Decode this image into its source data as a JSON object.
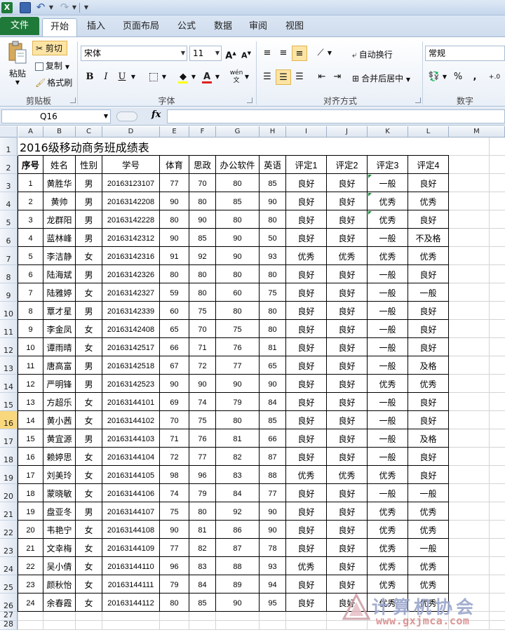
{
  "quick_access": {
    "app_icon": "X"
  },
  "tabs": [
    {
      "label": "文件",
      "icon": "excel-file-tab"
    },
    {
      "label": "开始"
    },
    {
      "label": "插入"
    },
    {
      "label": "页面布局"
    },
    {
      "label": "公式"
    },
    {
      "label": "数据"
    },
    {
      "label": "审阅"
    },
    {
      "label": "视图"
    }
  ],
  "ribbon": {
    "clipboard": {
      "paste": "粘贴",
      "cut": "剪切",
      "copy": "复制",
      "format_painter": "格式刷",
      "group": "剪贴板"
    },
    "font": {
      "name": "宋体",
      "size": "11",
      "bold": "B",
      "italic": "I",
      "underline": "U",
      "group": "字体",
      "grow": "A",
      "shrink": "A",
      "phonetic": "wén"
    },
    "alignment": {
      "wrap": "自动换行",
      "merge": "合并后居中",
      "group": "对齐方式"
    },
    "number": {
      "format": "常规",
      "percent": "%",
      "comma": ",",
      "group": "数字"
    }
  },
  "formula_bar": {
    "name_box": "Q16",
    "fx": "fx",
    "value": ""
  },
  "columns": [
    "A",
    "B",
    "C",
    "D",
    "E",
    "F",
    "G",
    "H",
    "I",
    "J",
    "K",
    "L",
    "M"
  ],
  "rows": [
    "1",
    "2",
    "3",
    "4",
    "5",
    "6",
    "7",
    "8",
    "9",
    "10",
    "11",
    "12",
    "13",
    "14",
    "15",
    "16",
    "17",
    "18",
    "19",
    "20",
    "21",
    "22",
    "23",
    "24",
    "25",
    "26",
    "27",
    "28"
  ],
  "selected_row": "16",
  "sheet": {
    "title": "2016级移动商务班成绩表",
    "headers": [
      "序号",
      "姓名",
      "性别",
      "学号",
      "体育",
      "思政",
      "办公软件",
      "英语",
      "评定1",
      "评定2",
      "评定3",
      "评定4"
    ],
    "records": [
      [
        "1",
        "黄胜华",
        "男",
        "20163123107",
        "77",
        "70",
        "80",
        "85",
        "良好",
        "良好",
        "一般",
        "良好"
      ],
      [
        "2",
        "黄帅",
        "男",
        "20163142208",
        "90",
        "80",
        "85",
        "90",
        "良好",
        "良好",
        "优秀",
        "优秀"
      ],
      [
        "3",
        "龙群阳",
        "男",
        "20163142228",
        "80",
        "90",
        "80",
        "80",
        "良好",
        "良好",
        "优秀",
        "良好"
      ],
      [
        "4",
        "蓝林峰",
        "男",
        "20163142312",
        "90",
        "85",
        "90",
        "50",
        "良好",
        "良好",
        "一般",
        "不及格"
      ],
      [
        "5",
        "李洁静",
        "女",
        "20163142316",
        "91",
        "92",
        "90",
        "93",
        "优秀",
        "优秀",
        "优秀",
        "优秀"
      ],
      [
        "6",
        "陆海斌",
        "男",
        "20163142326",
        "80",
        "80",
        "80",
        "80",
        "良好",
        "良好",
        "一般",
        "良好"
      ],
      [
        "7",
        "陆雅婷",
        "女",
        "20163142327",
        "59",
        "80",
        "60",
        "75",
        "良好",
        "良好",
        "一般",
        "一般"
      ],
      [
        "8",
        "覃才星",
        "男",
        "20163142339",
        "60",
        "75",
        "80",
        "80",
        "良好",
        "良好",
        "一般",
        "良好"
      ],
      [
        "9",
        "李金凤",
        "女",
        "20163142408",
        "65",
        "70",
        "75",
        "80",
        "良好",
        "良好",
        "一般",
        "良好"
      ],
      [
        "10",
        "谭雨晴",
        "女",
        "20163142517",
        "66",
        "71",
        "76",
        "81",
        "良好",
        "良好",
        "一般",
        "良好"
      ],
      [
        "11",
        "唐高富",
        "男",
        "20163142518",
        "67",
        "72",
        "77",
        "65",
        "良好",
        "良好",
        "一般",
        "及格"
      ],
      [
        "12",
        "严明锋",
        "男",
        "20163142523",
        "90",
        "90",
        "90",
        "90",
        "良好",
        "良好",
        "优秀",
        "优秀"
      ],
      [
        "13",
        "方超乐",
        "女",
        "20163144101",
        "69",
        "74",
        "79",
        "84",
        "良好",
        "良好",
        "一般",
        "良好"
      ],
      [
        "14",
        "黄小茜",
        "女",
        "20163144102",
        "70",
        "75",
        "80",
        "85",
        "良好",
        "良好",
        "一般",
        "良好"
      ],
      [
        "15",
        "黄宜源",
        "男",
        "20163144103",
        "71",
        "76",
        "81",
        "66",
        "良好",
        "良好",
        "一般",
        "及格"
      ],
      [
        "16",
        "赖婷思",
        "女",
        "20163144104",
        "72",
        "77",
        "82",
        "87",
        "良好",
        "良好",
        "一般",
        "良好"
      ],
      [
        "17",
        "刘美玲",
        "女",
        "20163144105",
        "98",
        "96",
        "83",
        "88",
        "优秀",
        "优秀",
        "优秀",
        "良好"
      ],
      [
        "18",
        "蒙晓敏",
        "女",
        "20163144106",
        "74",
        "79",
        "84",
        "77",
        "良好",
        "良好",
        "一般",
        "一般"
      ],
      [
        "19",
        "盘亚冬",
        "男",
        "20163144107",
        "75",
        "80",
        "92",
        "90",
        "良好",
        "良好",
        "优秀",
        "优秀"
      ],
      [
        "20",
        "韦艳宁",
        "女",
        "20163144108",
        "90",
        "81",
        "86",
        "90",
        "良好",
        "良好",
        "优秀",
        "优秀"
      ],
      [
        "21",
        "文幸梅",
        "女",
        "20163144109",
        "77",
        "82",
        "87",
        "78",
        "良好",
        "良好",
        "优秀",
        "一般"
      ],
      [
        "22",
        "吴小倩",
        "女",
        "20163144110",
        "96",
        "83",
        "88",
        "93",
        "优秀",
        "良好",
        "优秀",
        "优秀"
      ],
      [
        "23",
        "颜秋怡",
        "女",
        "20163144111",
        "79",
        "84",
        "89",
        "94",
        "良好",
        "良好",
        "优秀",
        "优秀"
      ],
      [
        "24",
        "余春霞",
        "女",
        "20163144112",
        "80",
        "85",
        "90",
        "95",
        "良好",
        "良好",
        "优秀",
        "优秀"
      ]
    ]
  },
  "watermark": {
    "name": "计算机协会",
    "url": "www.gxjmca.com"
  },
  "colors": {
    "accent_green": "#1f7a3a",
    "selected_row": "#f8d77d",
    "ribbon_bg": "#dbe6f4"
  }
}
